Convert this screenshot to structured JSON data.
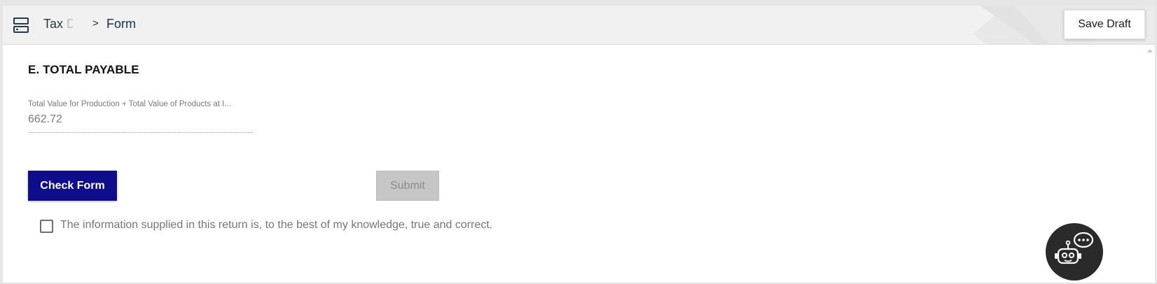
{
  "header": {
    "breadcrumb_root": "Tax Das",
    "breadcrumb_separator": ">",
    "breadcrumb_current": "Form",
    "save_draft_label": "Save Draft",
    "menu_icon": "server-menu-icon"
  },
  "section": {
    "title": "E. TOTAL PAYABLE"
  },
  "total_field": {
    "label": "Total Value for Production + Total Value of Products at I...",
    "value": "662.72"
  },
  "actions": {
    "check_form_label": "Check Form",
    "submit_label": "Submit",
    "submit_enabled": false
  },
  "declaration": {
    "checked": false,
    "text": "The information supplied in this return is, to the best of my knowledge, true and correct."
  },
  "assistant": {
    "icon": "chatbot-icon"
  },
  "colors": {
    "primary_button": "#0e0e8c",
    "disabled_button": "#c6c6c6",
    "topbar": "#f1f1f1",
    "assistant_bg": "#2a2a2a"
  }
}
